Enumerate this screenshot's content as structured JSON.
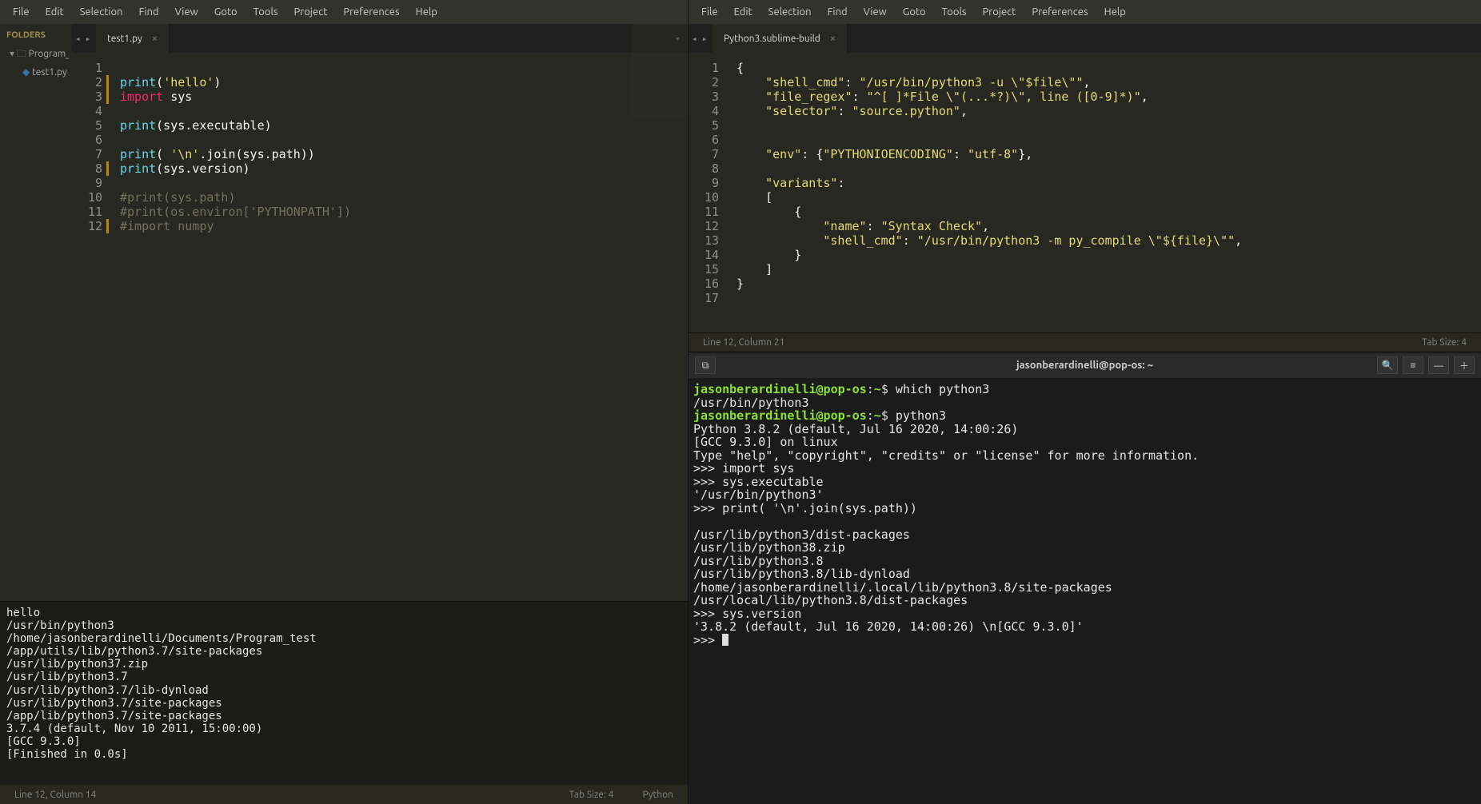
{
  "left": {
    "menu": [
      "File",
      "Edit",
      "Selection",
      "Find",
      "View",
      "Goto",
      "Tools",
      "Project",
      "Preferences",
      "Help"
    ],
    "sidebar": {
      "title": "FOLDERS",
      "folder": "Program_tes",
      "file": "test1.py"
    },
    "tab": {
      "name": "test1.py"
    },
    "code": {
      "lines": [
        "",
        "print('hello')",
        "import sys",
        "",
        "print(sys.executable)",
        "",
        "print( '\\n'.join(sys.path))",
        "print(sys.version)",
        "",
        "#print(sys.path)",
        "#print(os.environ['PYTHONPATH'])",
        "#import numpy"
      ]
    },
    "output": "hello\n/usr/bin/python3\n/home/jasonberardinelli/Documents/Program_test\n/app/utils/lib/python3.7/site-packages\n/usr/lib/python37.zip\n/usr/lib/python3.7\n/usr/lib/python3.7/lib-dynload\n/usr/lib/python3.7/site-packages\n/app/lib/python3.7/site-packages\n3.7.4 (default, Nov 10 2011, 15:00:00)\n[GCC 9.3.0]\n[Finished in 0.0s]",
    "status": {
      "pos": "Line 12, Column 14",
      "tabsize": "Tab Size: 4",
      "syntax": "Python"
    }
  },
  "right": {
    "menu": [
      "File",
      "Edit",
      "Selection",
      "Find",
      "View",
      "Goto",
      "Tools",
      "Project",
      "Preferences",
      "Help"
    ],
    "tab": {
      "name": "Python3.sublime-build"
    },
    "code": {
      "lines": [
        "{",
        "    \"shell_cmd\": \"/usr/bin/python3 -u \\\"$file\\\"\",",
        "    \"file_regex\": \"^[ ]*File \\\"(...*?)\\\", line ([0-9]*)\",",
        "    \"selector\": \"source.python\",",
        "",
        "",
        "    \"env\": {\"PYTHONIOENCODING\": \"utf-8\"},",
        "",
        "    \"variants\":",
        "    [",
        "        {",
        "            \"name\": \"Syntax Check\",",
        "            \"shell_cmd\": \"/usr/bin/python3 -m py_compile \\\"${file}\\\"\",",
        "        }",
        "    ]",
        "}",
        ""
      ]
    },
    "status": {
      "pos": "Line 12, Column 21",
      "tabsize": "Tab Size: 4"
    }
  },
  "terminal": {
    "title": "jasonberardinelli@pop-os: ~",
    "prompt_user": "jasonberardinelli@pop-os",
    "prompt_path": "~",
    "body_lines": [
      {
        "t": "prompt",
        "cmd": "which python3"
      },
      {
        "t": "out",
        "text": "/usr/bin/python3"
      },
      {
        "t": "prompt",
        "cmd": "python3"
      },
      {
        "t": "out",
        "text": "Python 3.8.2 (default, Jul 16 2020, 14:00:26)"
      },
      {
        "t": "out",
        "text": "[GCC 9.3.0] on linux"
      },
      {
        "t": "out",
        "text": "Type \"help\", \"copyright\", \"credits\" or \"license\" for more information."
      },
      {
        "t": "repl",
        "text": ">>> import sys"
      },
      {
        "t": "repl",
        "text": ">>> sys.executable"
      },
      {
        "t": "out",
        "text": "'/usr/bin/python3'"
      },
      {
        "t": "repl",
        "text": ">>> print( '\\n'.join(sys.path))"
      },
      {
        "t": "out",
        "text": ""
      },
      {
        "t": "out",
        "text": "/usr/lib/python3/dist-packages"
      },
      {
        "t": "out",
        "text": "/usr/lib/python38.zip"
      },
      {
        "t": "out",
        "text": "/usr/lib/python3.8"
      },
      {
        "t": "out",
        "text": "/usr/lib/python3.8/lib-dynload"
      },
      {
        "t": "out",
        "text": "/home/jasonberardinelli/.local/lib/python3.8/site-packages"
      },
      {
        "t": "out",
        "text": "/usr/local/lib/python3.8/dist-packages"
      },
      {
        "t": "repl",
        "text": ">>> sys.version"
      },
      {
        "t": "out",
        "text": "'3.8.2 (default, Jul 16 2020, 14:00:26) \\n[GCC 9.3.0]'"
      },
      {
        "t": "repl_cursor",
        "text": ">>> "
      }
    ]
  }
}
